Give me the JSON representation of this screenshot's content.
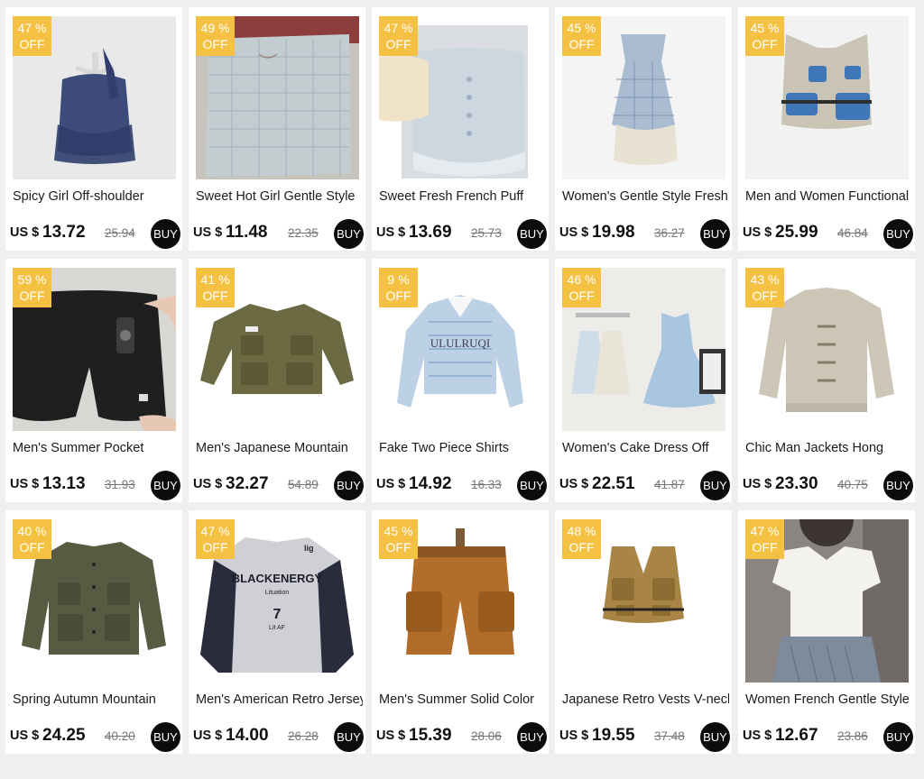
{
  "currency_label": "US $",
  "buy_label": "BUY",
  "badge_suffix": "%",
  "badge_off": "OFF",
  "colors": {
    "badge": "#f5c142",
    "buy_button": "#0c0c0c",
    "background": "#efefef"
  },
  "products": [
    {
      "discount": "47",
      "title": "Spicy Girl Off-shoulder",
      "price": "13.72",
      "old_price": "25.94",
      "image": "navy-off-shoulder-top"
    },
    {
      "discount": "49",
      "title": "Sweet Hot Girl Gentle Style",
      "price": "11.48",
      "old_price": "22.35",
      "image": "plaid-camisole"
    },
    {
      "discount": "47",
      "title": "Sweet Fresh French Puff",
      "price": "13.69",
      "old_price": "25.73",
      "image": "puff-sleeve-blouse"
    },
    {
      "discount": "45",
      "title": "Women's Gentle Style Fresh",
      "price": "19.98",
      "old_price": "36.27",
      "image": "plaid-slip-dress"
    },
    {
      "discount": "45",
      "title": "Men and Women Functional",
      "price": "25.99",
      "old_price": "46.84",
      "image": "utility-vest"
    },
    {
      "discount": "59",
      "title": "Men's Summer Pocket",
      "price": "13.13",
      "old_price": "31.93",
      "image": "black-cargo-shorts"
    },
    {
      "discount": "41",
      "title": "Men's Japanese Mountain",
      "price": "32.27",
      "old_price": "54.89",
      "image": "olive-field-jacket"
    },
    {
      "discount": "9",
      "title": "Fake Two Piece Shirts",
      "price": "14.92",
      "old_price": "16.33",
      "image": "striped-layered-shirt"
    },
    {
      "discount": "46",
      "title": "Women's Cake Dress Off",
      "price": "22.51",
      "old_price": "41.87",
      "image": "blue-cake-dress"
    },
    {
      "discount": "43",
      "title": "Chic Man Jackets Hong",
      "price": "23.30",
      "old_price": "40.75",
      "image": "beige-frog-button-jacket"
    },
    {
      "discount": "40",
      "title": "Spring Autumn Mountain",
      "price": "24.25",
      "old_price": "40.20",
      "image": "green-mountain-jacket"
    },
    {
      "discount": "47",
      "title": "Men's American Retro Jersey",
      "price": "14.00",
      "old_price": "26.28",
      "image": "retro-jersey"
    },
    {
      "discount": "45",
      "title": "Men's Summer Solid Color",
      "price": "15.39",
      "old_price": "28.06",
      "image": "orange-cargo-shorts"
    },
    {
      "discount": "48",
      "title": "Japanese Retro Vests V-neck",
      "price": "19.55",
      "old_price": "37.48",
      "image": "khaki-utility-vest"
    },
    {
      "discount": "47",
      "title": "Women French Gentle Style",
      "price": "12.67",
      "old_price": "23.86",
      "image": "white-ruffle-blouse"
    }
  ],
  "jersey_print": {
    "brand": "BLACKENERGY",
    "sub": "Lituation",
    "number": "7",
    "small": "Lit AF",
    "logo": "lig"
  },
  "shirt_print": "ULULRUQI"
}
